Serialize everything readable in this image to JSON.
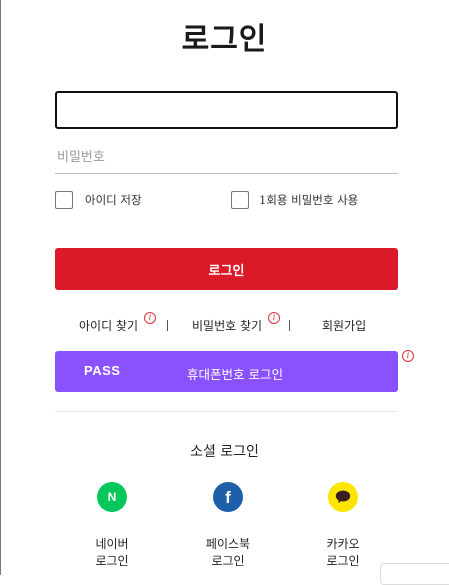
{
  "page": {
    "title": "로그인"
  },
  "form": {
    "id_value": "",
    "password_placeholder": "비밀번호",
    "save_id_label": "아이디 저장",
    "one_time_password_label": "1회용 비밀번호 사용",
    "login_button": "로그인"
  },
  "links": {
    "find_id": "아이디 찾기",
    "find_password": "비밀번호 찾기",
    "signup": "회원가입",
    "info_glyph": "i"
  },
  "pass": {
    "logo": "PASS",
    "label": "휴대폰번호 로그인"
  },
  "social": {
    "title": "소셜 로그인",
    "items": [
      {
        "line1": "네이버",
        "line2": "로그인",
        "glyph": "N",
        "color": "#03c75a",
        "icon": "naver-icon"
      },
      {
        "line1": "페이스북",
        "line2": "로그인",
        "glyph": "f",
        "color": "#1d5fa8",
        "icon": "facebook-icon"
      },
      {
        "line1": "카카오",
        "line2": "로그인",
        "glyph": "",
        "color": "#fee500",
        "icon": "kakao-icon"
      }
    ]
  },
  "colors": {
    "login_button": "#da1a28",
    "pass_button": "#8a52ff",
    "info_icon": "#e0303a"
  }
}
